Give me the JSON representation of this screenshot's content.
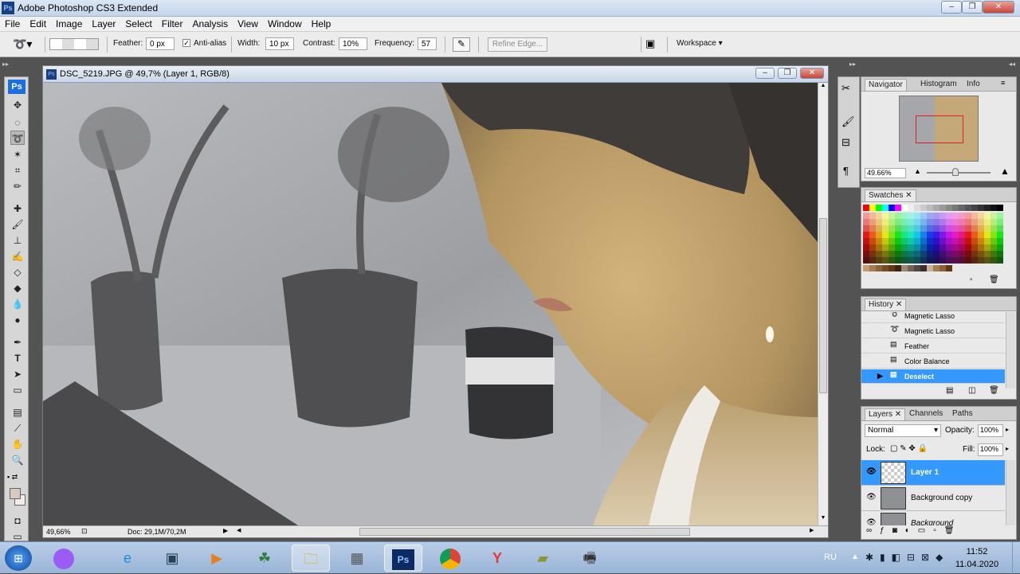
{
  "window": {
    "title": "Adobe Photoshop CS3 Extended",
    "app_badge": "Ps"
  },
  "menu": [
    "File",
    "Edit",
    "Image",
    "Layer",
    "Select",
    "Filter",
    "Analysis",
    "View",
    "Window",
    "Help"
  ],
  "options": {
    "feather_label": "Feather:",
    "feather_value": "0 px",
    "antialias_label": "Anti-alias",
    "antialias_checked": true,
    "width_label": "Width:",
    "width_value": "10 px",
    "contrast_label": "Contrast:",
    "contrast_value": "10%",
    "frequency_label": "Frequency:",
    "frequency_value": "57",
    "refine_edge": "Refine Edge...",
    "workspace": "Workspace"
  },
  "toolbox": {
    "badge": "Ps"
  },
  "document": {
    "title": "DSC_5219.JPG @ 49,7% (Layer 1, RGB/8)",
    "zoom": "49,66%",
    "doc_info": "Doc: 29,1M/70,2M"
  },
  "navigator": {
    "tabs": [
      "Navigator",
      "Histogram",
      "Info"
    ],
    "zoom": "49.66%",
    "zoom_slider_fraction": 0.45
  },
  "swatches": {
    "tab": "Swatches"
  },
  "history": {
    "tab": "History",
    "items": [
      "Magnetic Lasso",
      "Magnetic Lasso",
      "Feather",
      "Color Balance",
      "Deselect"
    ],
    "selected_index": 4
  },
  "layers": {
    "tabs": [
      "Layers",
      "Channels",
      "Paths"
    ],
    "blend_mode": "Normal",
    "opacity_label": "Opacity:",
    "opacity": "100%",
    "lock_label": "Lock:",
    "fill_label": "Fill:",
    "fill": "100%",
    "items": [
      "Layer 1",
      "Background copy",
      "Background"
    ],
    "selected_index": 0
  },
  "taskbar": {
    "lang": "RU",
    "time": "11:52",
    "date": "11.04.2020",
    "apps": [
      "windows-start",
      "cortana",
      "internet-explorer",
      "app-window",
      "media-player",
      "people",
      "file-explorer",
      "calculator",
      "photoshop",
      "chrome",
      "yandex",
      "notepad",
      "fax"
    ]
  },
  "colors": {
    "accent": "#3399ff",
    "selection": "#3399ff"
  }
}
